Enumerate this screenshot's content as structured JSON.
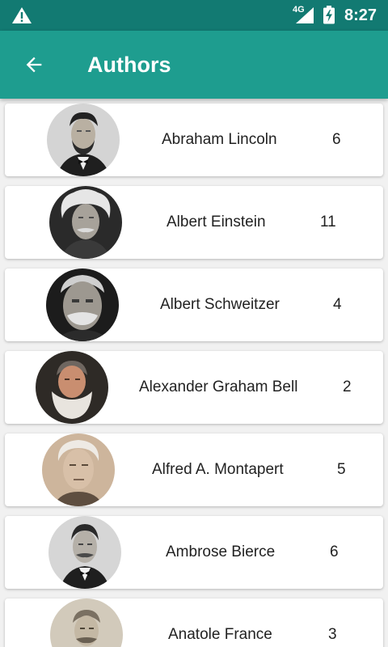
{
  "status_bar": {
    "network": "4G",
    "time": "8:27"
  },
  "app_bar": {
    "title": "Authors",
    "back_icon": "arrow-back-icon"
  },
  "authors": [
    {
      "name": "Abraham Lincoln",
      "count": "6"
    },
    {
      "name": "Albert Einstein",
      "count": "11"
    },
    {
      "name": "Albert Schweitzer",
      "count": "4"
    },
    {
      "name": "Alexander Graham Bell",
      "count": "2"
    },
    {
      "name": "Alfred A. Montapert",
      "count": "5"
    },
    {
      "name": "Ambrose Bierce",
      "count": "6"
    },
    {
      "name": "Anatole France",
      "count": "3"
    }
  ],
  "colors": {
    "status_bar": "#127a72",
    "app_bar": "#1e9d8f",
    "background": "#f1f1f1"
  }
}
